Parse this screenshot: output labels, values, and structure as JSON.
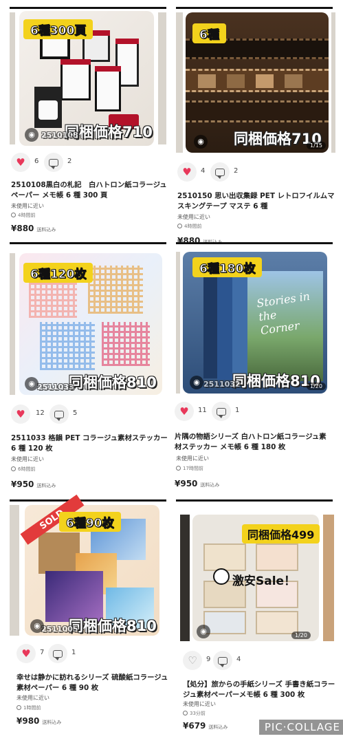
{
  "items": [
    {
      "badge": "6種300頁",
      "promo": "同梱価格710",
      "code": "2510108",
      "likes": "6",
      "comments": "2",
      "liked": true,
      "title_lines": [
        "2510108黒白の札記　白ハトロン紙コラージュ",
        "ペーパー メモ帳 6 種 300 頁"
      ],
      "condition": "未使用に近い",
      "time": "4時間前",
      "price": "¥880",
      "shipping": "送料込み"
    },
    {
      "badge": "6種",
      "promo": "同梱価格710",
      "code": "",
      "pager": "1/15",
      "likes": "4",
      "comments": "2",
      "liked": true,
      "title_lines": [
        "2510150 思い出収集録 PET レトロフイルムマ",
        "スキングテープ マステ 6 種"
      ],
      "condition": "未使用に近い",
      "time": "4時間前",
      "price": "¥880",
      "shipping": "送料込み"
    },
    {
      "badge": "6種120枚",
      "promo": "同梱価格810",
      "code": "2511033",
      "likes": "12",
      "comments": "5",
      "liked": true,
      "title_lines": [
        "2511033 格韻 PET コラージュ素材ステッカー",
        "6 種 120 枚"
      ],
      "condition": "未使用に近い",
      "time": "6時間前",
      "price": "¥950",
      "shipping": "送料込み"
    },
    {
      "badge": "6種180枚",
      "promo": "同梱価格810",
      "code": "2511032",
      "pager": "1/20",
      "likes": "11",
      "comments": "1",
      "liked": true,
      "title_lines": [
        "片隅の物語シリーズ 白ハトロン紙コラージュ素",
        "材ステッカー メモ帳 6 種 180 枚"
      ],
      "condition": "未使用に近い",
      "time": "17時間前",
      "price": "¥950",
      "shipping": "送料込み"
    },
    {
      "badge": "6種90枚",
      "sold": "SOLD",
      "promo": "同梱価格810",
      "code": "2511005",
      "likes": "7",
      "comments": "1",
      "liked": true,
      "title_lines": [
        "幸せは静かに訪れるシリーズ 硫酸紙コラージュ",
        "素材ペーパー 6 種 90 枚"
      ],
      "condition": "未使用に近い",
      "time": "1時間前",
      "price": "¥980",
      "shipping": "送料込み"
    },
    {
      "promo_pill": "同梱価格499",
      "sale": "激安Sale！",
      "pager": "1/20",
      "likes": "9",
      "comments": "4",
      "liked": false,
      "title_lines": [
        "【処分】旅からの手紙シリーズ 手書き紙コラー",
        "ジュ素材ペーパーメモ帳 6 種 300 枚"
      ],
      "condition": "未使用に近い",
      "time": "33分前",
      "price": "¥679",
      "shipping": "送料込み"
    }
  ],
  "watermark": "PIC·COLLAGE",
  "colors": {
    "heart": "#e8385a",
    "badge": "#f3d21c",
    "sold": "#e23b3b"
  }
}
